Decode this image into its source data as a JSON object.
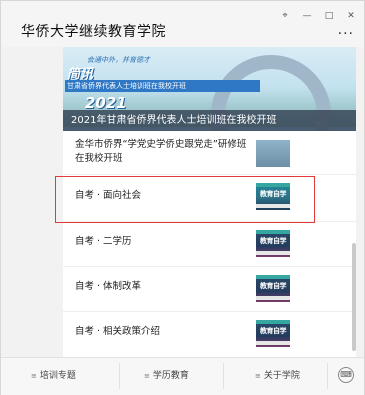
{
  "window": {
    "title": "华侨大学继续教育学院",
    "controls": {
      "pin_icon": "pin-icon",
      "minimize": "—",
      "maximize": "□",
      "close": "✕",
      "more": "···"
    }
  },
  "banner": {
    "slogan": "会通中外，并育德才",
    "tag": "简讯",
    "subtitle": "甘肃省侨界代表人士培训班在我校开班",
    "year": "2021",
    "caption": "2021年甘肃省侨界代表人士培训班在我校开班"
  },
  "list": {
    "items": [
      {
        "title_line1": "金华市侨界“学党史学侨史跟党走”研修班",
        "title_line2": "在我校开班",
        "thumb_icon": "article-thumbnail"
      },
      {
        "title": "自考 · 面向社会",
        "thumb_text": "教育自学",
        "thumb_icon": "self-study-thumbnail"
      },
      {
        "title": "自考 · 二学历",
        "thumb_text": "教育自学",
        "thumb_icon": "self-study-thumbnail"
      },
      {
        "title": "自考 · 体制改革",
        "thumb_text": "教育自学",
        "thumb_icon": "self-study-thumbnail"
      },
      {
        "title": "自考 · 相关政策介绍",
        "thumb_text": "教育自学",
        "thumb_icon": "self-study-thumbnail"
      }
    ],
    "highlighted_index": 1
  },
  "bottom_tabs": [
    {
      "label": "培训专题",
      "icon": "≡"
    },
    {
      "label": "学历教育",
      "icon": "≡"
    },
    {
      "label": "关于学院",
      "icon": "≡"
    }
  ],
  "keyboard_icon": "keyboard-icon",
  "colors": {
    "highlight_border": "#e23a3a",
    "caption_bg": "#283246"
  }
}
